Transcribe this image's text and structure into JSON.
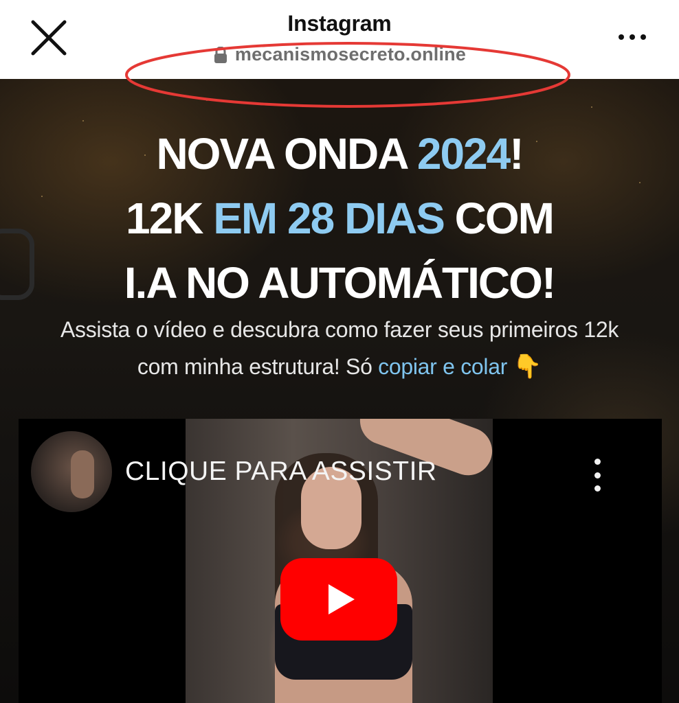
{
  "browser": {
    "app_title": "Instagram",
    "url": "mecanismosecreto.online",
    "icons": {
      "close": "close-icon",
      "lock": "lock-icon",
      "more": "more-options-icon"
    },
    "highlight_color": "#e53935"
  },
  "page": {
    "headline": {
      "line1": {
        "text": "NOVA ONDA ",
        "accent": "2024",
        "tail": "!"
      },
      "line2": {
        "lead": "12K ",
        "accent": "EM 28 DIAS",
        "tail": " COM"
      },
      "line3": "I.A NO AUTOMÁTICO!"
    },
    "subtitle": {
      "line1": "Assista o vídeo e descubra como fazer seus primeiros 12k",
      "line2_lead": "com minha estrutura! Só ",
      "line2_link": "copiar e colar",
      "emoji": "👇"
    },
    "colors": {
      "accent": "#8ecbf1",
      "background": "#151310"
    }
  },
  "video": {
    "title": "CLIQUE PARA ASSISTIR",
    "icons": {
      "play": "play-icon",
      "menu": "vertical-dots-icon"
    },
    "play_color": "#ff0000"
  }
}
